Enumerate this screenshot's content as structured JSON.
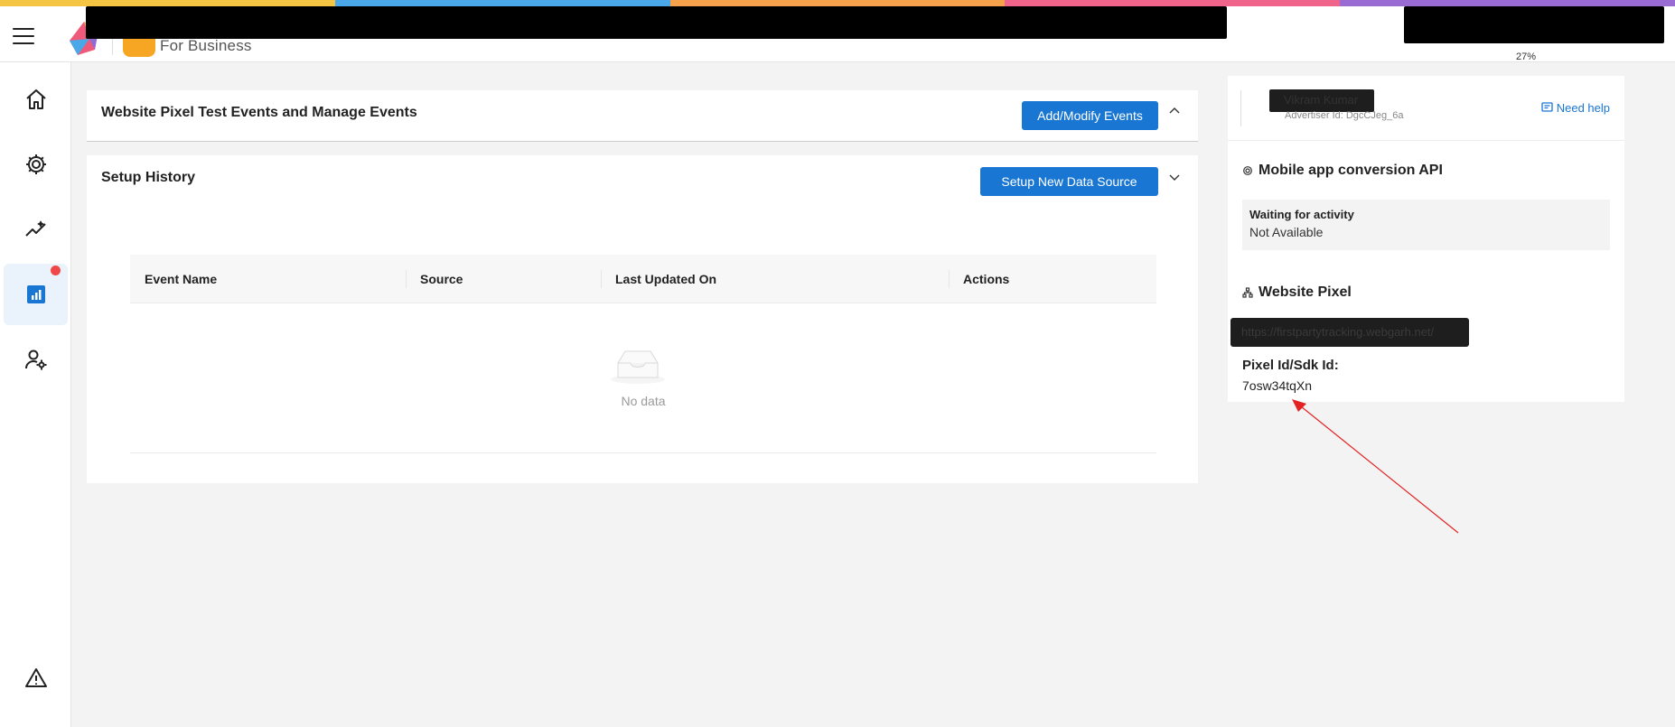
{
  "colors": {
    "rainbow": [
      "#f4c542",
      "#4aa8e8",
      "#f5a04a",
      "#f0648c",
      "#9b6bd4"
    ],
    "accent": "#1976d2",
    "badge": "#f04848",
    "arrow": "#e32323"
  },
  "header": {
    "brand_sub": "For Business",
    "usage_percent": "27%"
  },
  "sidebar": {
    "items": [
      {
        "name": "home",
        "icon": "home-icon"
      },
      {
        "name": "settings",
        "icon": "gear-icon"
      },
      {
        "name": "insights",
        "icon": "trend-icon"
      },
      {
        "name": "reports",
        "icon": "report-chart-icon",
        "active": true,
        "has_badge": true
      },
      {
        "name": "user-settings",
        "icon": "user-gear-icon"
      },
      {
        "name": "alerts",
        "icon": "warning-icon"
      }
    ]
  },
  "events_card": {
    "title": "Website Pixel Test Events and Manage Events",
    "button": "Add/Modify Events"
  },
  "history_card": {
    "title": "Setup History",
    "button": "Setup New Data Source",
    "columns": [
      "Event Name",
      "Source",
      "Last Updated On",
      "Actions"
    ],
    "empty_text": "No data"
  },
  "right_panel": {
    "user_name": "Vikram Kumar",
    "advertiser_id": "Advertiser Id: DgcCJeg_6a",
    "need_help": "Need help",
    "mobile_api": {
      "title": "Mobile app conversion API",
      "status_title": "Waiting for activity",
      "status_value": "Not Available"
    },
    "website_pixel": {
      "title": "Website Pixel",
      "url": "https://firstpartytracking.webgarh.net/",
      "pixel_label": "Pixel Id/Sdk Id:",
      "pixel_value": "7osw34tqXn"
    }
  }
}
